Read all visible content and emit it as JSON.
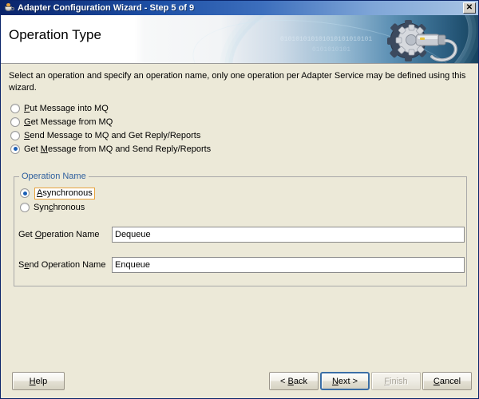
{
  "window": {
    "title": "Adapter Configuration Wizard - Step 5 of 9",
    "icon": "java-coffee-cup-icon",
    "close_label": "✕"
  },
  "header": {
    "title": "Operation Type",
    "binary_line_1": "010101010101010101010101",
    "binary_line_2": "0101010101",
    "art": "gear-and-cable-icon"
  },
  "main": {
    "instructions": "Select an operation and specify an operation name, only one operation per Adapter Service may be defined using this wizard.",
    "operations": [
      {
        "label_before": "P",
        "label_mnemonic": "P",
        "label_a": "",
        "label_b": "ut Message into MQ",
        "full": "Put Message into MQ",
        "selected": false
      },
      {
        "label_a": "",
        "label_mnemonic": "G",
        "label_b": "et Message from MQ",
        "full": "Get Message from MQ",
        "selected": false
      },
      {
        "label_a": "",
        "label_mnemonic": "S",
        "label_b": "end Message to MQ and Get Reply/Reports",
        "full": "Send Message to MQ and Get Reply/Reports",
        "selected": false
      },
      {
        "label_a": "Get ",
        "label_mnemonic": "M",
        "label_b": "essage from MQ and Send Reply/Reports",
        "full": "Get Message from MQ and Send Reply/Reports",
        "selected": true
      }
    ]
  },
  "operation_name_group": {
    "legend": "Operation Name",
    "async": {
      "label_a": "",
      "label_mnemonic": "A",
      "label_b": "synchronous",
      "full": "Asynchronous",
      "selected": true,
      "focused": true
    },
    "sync": {
      "label_a": "Syn",
      "label_mnemonic": "c",
      "label_b": "hronous",
      "full": "Synchronous",
      "selected": false,
      "focused": false
    },
    "get_field": {
      "label_a": "Get ",
      "label_mnemonic": "O",
      "label_b": "peration Name",
      "full_label": "Get Operation Name",
      "value": "Dequeue",
      "placeholder": ""
    },
    "send_field": {
      "label_a": "S",
      "label_mnemonic": "e",
      "label_b": "nd Operation Name",
      "full_label": "Send Operation Name",
      "value": "Enqueue",
      "placeholder": ""
    }
  },
  "buttons": {
    "help": {
      "label_a": "",
      "label_mnemonic": "H",
      "label_b": "elp",
      "full": "Help",
      "disabled": false,
      "default": false
    },
    "back": {
      "label_a": "< ",
      "label_mnemonic": "B",
      "label_b": "ack",
      "full": "< Back",
      "disabled": false,
      "default": false
    },
    "next": {
      "label_a": "",
      "label_mnemonic": "N",
      "label_b": "ext >",
      "full": "Next >",
      "disabled": false,
      "default": true
    },
    "finish": {
      "label_a": "",
      "label_mnemonic": "F",
      "label_b": "inish",
      "full": "Finish",
      "disabled": true,
      "default": false
    },
    "cancel": {
      "label_a": "",
      "label_mnemonic": "C",
      "label_b": "ancel",
      "full": "Cancel",
      "disabled": false,
      "default": false
    }
  },
  "colors": {
    "titlebar_start": "#0a246a",
    "titlebar_end": "#a8c4e4",
    "dialog_bg": "#ece9d8",
    "legend_blue": "#30609e",
    "radio_dot": "#1b5fb5",
    "focus_ring": "#e8a33d",
    "default_button_border": "#3b6ea5",
    "disabled_text": "#a8a49a"
  }
}
